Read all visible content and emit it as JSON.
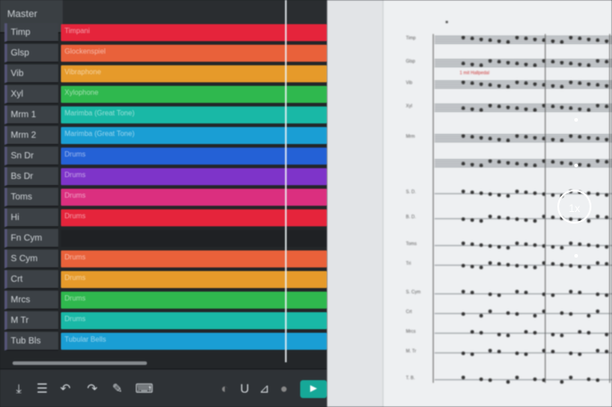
{
  "master_label": "Master",
  "tracks": [
    {
      "name": "Timp",
      "clip": "Timpani",
      "color": "#e5243b"
    },
    {
      "name": "Glsp",
      "clip": "Glockenspiel",
      "color": "#e9613a"
    },
    {
      "name": "Vib",
      "clip": "Vibraphone",
      "color": "#e69a2a"
    },
    {
      "name": "Xyl",
      "clip": "Xylophone",
      "color": "#2fb84e"
    },
    {
      "name": "Mrm 1",
      "clip": "Marimba (Great Tone)",
      "color": "#19b8a6"
    },
    {
      "name": "Mrm 2",
      "clip": "Marimba (Great Tone)",
      "color": "#1a9ed4"
    },
    {
      "name": "Sn Dr",
      "clip": "Drums",
      "color": "#2461d6"
    },
    {
      "name": "Bs Dr",
      "clip": "Drums",
      "color": "#7e34c9"
    },
    {
      "name": "Toms",
      "clip": "Drums",
      "color": "#db2f7f"
    },
    {
      "name": "Hi",
      "clip": "Drums",
      "color": "#e5243b"
    },
    {
      "name": "Fn Cym",
      "clip": "",
      "color": "#1f2124"
    },
    {
      "name": "S Cym",
      "clip": "Drums",
      "color": "#e9613a"
    },
    {
      "name": "Crt",
      "clip": "Drums",
      "color": "#e69a2a"
    },
    {
      "name": "Mrcs",
      "clip": "Drums",
      "color": "#2fb84e"
    },
    {
      "name": "M Tr",
      "clip": "Drums",
      "color": "#19b8a6"
    },
    {
      "name": "Tub Bls",
      "clip": "Tubular Bells",
      "color": "#1a9ed4"
    }
  ],
  "toolbar": {
    "items": [
      "download-icon",
      "menu-icon",
      "undo-icon",
      "redo-icon",
      "wrench-icon",
      "keyboard-icon",
      "headphones-icon",
      "magnet-icon",
      "metronome-icon",
      "record-icon"
    ],
    "play_label": "▶"
  },
  "score": {
    "labels": [
      "Timp",
      "Glsp",
      "Vib",
      "Xyl",
      "Mrm",
      "",
      "S. D.",
      "B. D.",
      "Toms",
      "Tri",
      "S. Cym",
      "Crt",
      "Mrcs",
      "M. Tr",
      "T. B."
    ],
    "annotation": "1 mit Hallpedal",
    "zoom_label": "1x"
  }
}
